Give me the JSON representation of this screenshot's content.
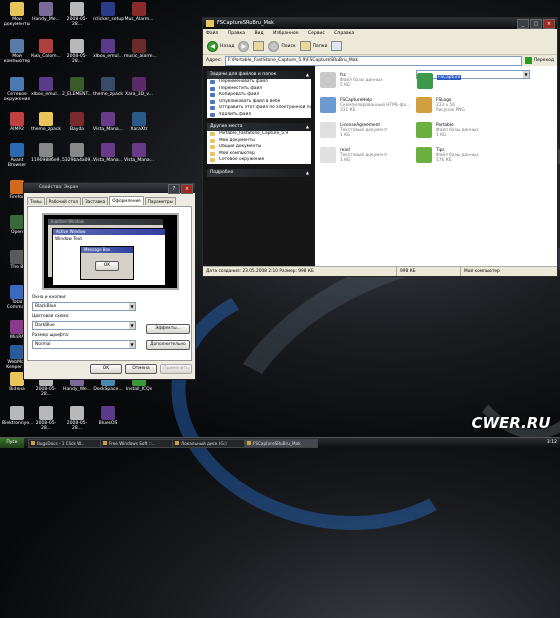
{
  "desktop": {
    "icons": [
      {
        "label": "Мои документы",
        "color": "#e8c45a"
      },
      {
        "label": "Handy_Ме...",
        "color": "#7a6a9a"
      },
      {
        "label": "2008-05-28...",
        "color": "#b8b8b8"
      },
      {
        "label": "rclicker_setup",
        "color": "#2a3a8a"
      },
      {
        "label": "Mus_Alarm...",
        "color": "#8a2a2a"
      },
      {
        "label": "Мой компьютер",
        "color": "#5a7aa8"
      },
      {
        "label": "Киа_Colom...",
        "color": "#b04040"
      },
      {
        "label": "2008-05-28...",
        "color": "#b8b8b8"
      },
      {
        "label": "xlbox_emul...",
        "color": "#5a3a8a"
      },
      {
        "label": "music_alarm...",
        "color": "#6a2a2a"
      },
      {
        "label": "Сетевое окружение",
        "color": "#4a7ab0"
      },
      {
        "label": "xlbox_emul...",
        "color": "#5a3a8a"
      },
      {
        "label": "2_ELEMENT...",
        "color": "#3a5a2a"
      },
      {
        "label": "theme_zpack",
        "color": "#3a4a6a"
      },
      {
        "label": "Хara_3D_v...",
        "color": "#5a2a6a"
      },
      {
        "label": "AIMP2",
        "color": "#c04040"
      },
      {
        "label": "theme_zpack",
        "color": "#e8c45a"
      },
      {
        "label": "Bayda",
        "color": "#7a2a2a"
      },
      {
        "label": "Vista_Mana...",
        "color": "#6a3a8a"
      },
      {
        "label": "XaraXtr",
        "color": "#2a5a8a"
      },
      {
        "label": "Avant Browser",
        "color": "#2a6ab0"
      },
      {
        "label": "11909886e9...",
        "color": "#888888"
      },
      {
        "label": "5329ba4a09...",
        "color": "#888888"
      },
      {
        "label": "Vista_Mana...",
        "color": "#6a3a8a"
      },
      {
        "label": "Vista_Mana...",
        "color": "#6a3a8a"
      },
      {
        "label": "Firefox",
        "color": "#d06a20"
      },
      {
        "label": "Open",
        "color": "#3a6a3a"
      },
      {
        "label": "The B",
        "color": "#5a5a5a"
      },
      {
        "label": "Total Comman",
        "color": "#3a6ac0"
      },
      {
        "label": "WinRA",
        "color": "#8a3a8a"
      },
      {
        "label": "WebMon Keeper Cl",
        "color": "#2a5a9a"
      },
      {
        "label": "Bidяна",
        "color": "#e8c45a"
      },
      {
        "label": "2008-05-28...",
        "color": "#b8b8b8"
      },
      {
        "label": "Handy_We...",
        "color": "#7a6a9a"
      },
      {
        "label": "DeskSpace...",
        "color": "#4a8ab0"
      },
      {
        "label": "Install_ICQs",
        "color": "#3a9a3a"
      },
      {
        "label": "Biektronnye...",
        "color": "#b8b8b8"
      },
      {
        "label": "2008-05-28...",
        "color": "#b8b8b8"
      },
      {
        "label": "2008-05-28...",
        "color": "#b8b8b8"
      },
      {
        "label": "BluesOS",
        "color": "#5a3a8a"
      }
    ]
  },
  "explorer": {
    "title": "FSCaptureSRuBru_Mak",
    "menu": [
      "Файл",
      "Правка",
      "Вид",
      "Избранное",
      "Сервис",
      "Справка"
    ],
    "toolbar": {
      "back": "Назад",
      "search": "Поиск",
      "folders": "Папки"
    },
    "address_label": "Адрес:",
    "address": "F:\\Portable_FastStone_Capture_5.9\\FSCaptureSRuBru_Mak",
    "go": "Переход",
    "tasks_title": "Задачи для файлов и папок",
    "tasks": [
      "Переименовать файл",
      "Переместить файл",
      "Копировать файл",
      "Опубликовать файл в вебе",
      "Отправить этот файл по электронной почте",
      "Удалить файл"
    ],
    "places_title": "Другие места",
    "places": [
      "Portable_FastStone_Capture_5.9",
      "Мои документы",
      "Общие документы",
      "Мой компьютер",
      "Сетевое окружение"
    ],
    "details_title": "Подробно",
    "files": [
      {
        "name": "fsc",
        "line2": "Файл базы данных",
        "line3": "5 КБ",
        "color": "#c8c8c8",
        "selected": false
      },
      {
        "name": "FSCapture",
        "line2": "",
        "line3": "",
        "color": "#3a9a4a",
        "selected": true
      },
      {
        "name": "FSCaptureHelp",
        "line2": "Скомпилированный HTML-фа...",
        "line3": "331 КБ",
        "color": "#6a9ad0",
        "selected": false
      },
      {
        "name": "FSLogo",
        "line2": "233 x 56",
        "line3": "Рисунок PNG",
        "color": "#d0a040",
        "selected": false
      },
      {
        "name": "LicenseAgreement",
        "line2": "Текстовый документ",
        "line3": "1 КБ",
        "color": "#e0e0e0",
        "selected": false
      },
      {
        "name": "Portable",
        "line2": "Файл базы данных",
        "line3": "1 КБ",
        "color": "#6ab040",
        "selected": false
      },
      {
        "name": "read",
        "line2": "Текстовый документ",
        "line3": "1 КБ",
        "color": "#e0e0e0",
        "selected": false
      },
      {
        "name": "Tips",
        "line2": "Файл базы данных",
        "line3": "176 КБ",
        "color": "#6ab040",
        "selected": false
      }
    ],
    "status_left": "Дата создания: 23.05.2008 2:10 Размер: 998 КБ",
    "status_mid": "998 КБ",
    "status_right": "Мой компьютер"
  },
  "dialog": {
    "title": "Свойства: Экран",
    "tabs": [
      "Темы",
      "Рабочий стол",
      "Заставка",
      "Оформление",
      "Параметры"
    ],
    "active_tab": "Оформление",
    "preview": {
      "inactive": "Inactive Window",
      "active": "Active Window",
      "window_text": "Window Text",
      "message_box": "Message Box",
      "ok": "OK"
    },
    "windows_buttons_label": "Окна и кнопки:",
    "windows_buttons_value": "BlackBlue",
    "color_scheme_label": "Цветовая схема:",
    "color_scheme_value": "DarkBlue",
    "font_size_label": "Размер шрифта:",
    "font_size_value": "Normal",
    "effects": "Эффекты...",
    "advanced": "Дополнительно",
    "ok": "OK",
    "cancel": "Отмена",
    "apply": "Применить"
  },
  "taskbar": {
    "start": "Пуск",
    "tasks": [
      {
        "label": "BugsDocs - 1 Click W...",
        "active": false
      },
      {
        "label": "Free Windows Soft ::...",
        "active": false
      },
      {
        "label": "Локальный диск (G:)",
        "active": false
      },
      {
        "label": "FSCaptureSRuBru_Mak",
        "active": true
      }
    ],
    "clock": "3:12"
  },
  "watermark": "CWER.RU"
}
